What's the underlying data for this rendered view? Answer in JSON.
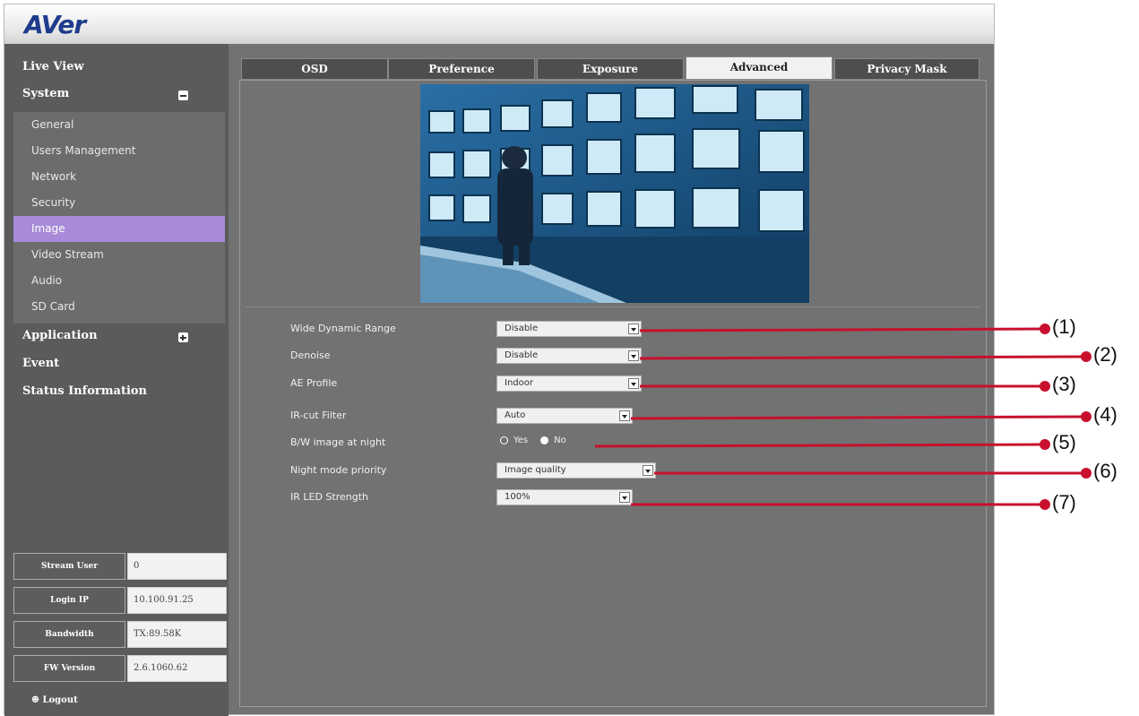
{
  "header": {
    "logo": "AVer"
  },
  "sidebar": {
    "nav": [
      {
        "label": "Live View"
      },
      {
        "label": "System"
      },
      {
        "label": "Application"
      },
      {
        "label": "Event"
      },
      {
        "label": "Status Information"
      }
    ],
    "system_items": [
      "General",
      "Users Management",
      "Network",
      "Security",
      "Image",
      "Video Stream",
      "Audio",
      "SD Card"
    ],
    "active_item": "Image",
    "info": [
      {
        "label": "Stream User",
        "value": "0"
      },
      {
        "label": "Login IP",
        "value": "10.100.91.25"
      },
      {
        "label": "Bandwidth",
        "value": "TX:89.58K"
      },
      {
        "label": "FW Version",
        "value": "2.6.1060.62"
      }
    ],
    "logout": "Logout"
  },
  "tabs": [
    {
      "label": "OSD"
    },
    {
      "label": "Preference"
    },
    {
      "label": "Exposure"
    },
    {
      "label": "Advanced"
    },
    {
      "label": "Privacy Mask"
    }
  ],
  "active_tab": "Advanced",
  "settings": {
    "wdr": {
      "label": "Wide Dynamic Range",
      "value": "Disable"
    },
    "denoise": {
      "label": "Denoise",
      "value": "Disable"
    },
    "ae_profile": {
      "label": "AE Profile",
      "value": "Indoor"
    },
    "ircut": {
      "label": "IR-cut Filter",
      "value": "Auto"
    },
    "bw_night": {
      "label": "B/W image at night",
      "yes": "Yes",
      "no": "No",
      "selected": "No"
    },
    "night_priority": {
      "label": "Night mode priority",
      "value": "Image quality"
    },
    "ir_led": {
      "label": "IR LED Strength",
      "value": "100%"
    }
  },
  "callouts": [
    "(1)",
    "(2)",
    "(3)",
    "(4)",
    "(5)",
    "(6)",
    "(7)"
  ],
  "colors": {
    "callout": "#c8102e",
    "active_nav": "#a78bd9",
    "panel": "#727272"
  }
}
